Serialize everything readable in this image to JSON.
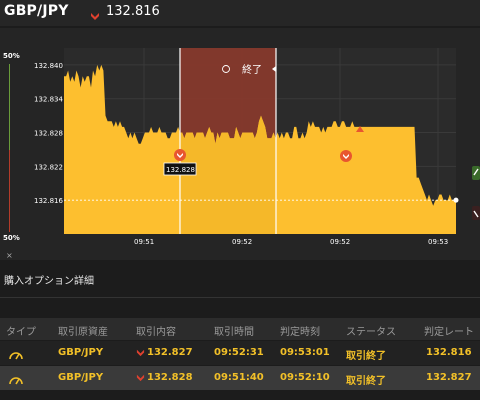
{
  "header": {
    "pair": "GBP/JPY",
    "rate": "132.816",
    "direction_icon": "down-arrow-icon",
    "colors": {
      "down": "#e0412f"
    }
  },
  "chart": {
    "gauge_top": "50%",
    "gauge_bottom": "50%",
    "close_symbol": "×",
    "end_label": "終了",
    "price_tag": "132.828"
  },
  "chart_data": {
    "type": "area",
    "x_tick_labels": [
      "09:51",
      "09:52",
      "09:52",
      "09:53"
    ],
    "y_tick_labels": [
      "132.840",
      "132.834",
      "132.828",
      "132.822",
      "132.816"
    ],
    "ylim": [
      132.81,
      132.843
    ],
    "y": [
      132.838,
      132.838,
      132.839,
      132.837,
      132.838,
      132.837,
      132.839,
      132.838,
      132.836,
      132.838,
      132.837,
      132.838,
      132.838,
      132.836,
      132.839,
      132.838,
      132.84,
      132.839,
      132.84,
      132.839,
      132.831,
      132.83,
      132.83,
      132.83,
      132.829,
      132.83,
      132.829,
      132.83,
      132.829,
      132.829,
      132.828,
      132.827,
      132.828,
      132.827,
      132.828,
      132.827,
      132.826,
      132.826,
      132.827,
      132.828,
      132.828,
      132.828,
      132.829,
      132.828,
      132.828,
      132.828,
      132.829,
      132.828,
      132.828,
      132.828,
      132.827,
      132.827,
      132.828,
      132.828,
      132.828,
      132.829,
      132.828,
      132.828,
      132.827,
      132.828,
      132.828,
      132.828,
      132.828,
      132.827,
      132.828,
      132.828,
      132.828,
      132.828,
      132.827,
      132.828,
      132.829,
      132.828,
      132.828,
      132.826,
      132.828,
      132.827,
      132.828,
      132.828,
      132.828,
      132.828,
      132.827,
      132.827,
      132.827,
      132.829,
      132.828,
      132.827,
      132.828,
      132.828,
      132.828,
      132.828,
      132.828,
      132.828,
      132.827,
      132.828,
      132.83,
      132.831,
      132.83,
      132.829,
      132.827,
      132.827,
      132.827,
      132.828,
      132.827,
      132.828,
      132.827,
      132.828,
      132.827,
      132.828,
      132.828,
      132.827,
      132.827,
      132.829,
      132.829,
      132.827,
      132.827,
      132.828,
      132.827,
      132.828,
      132.83,
      132.829,
      132.83,
      132.829,
      132.829,
      132.829,
      132.828,
      132.829,
      132.828,
      132.829,
      132.829,
      132.829,
      132.83,
      132.83,
      132.829,
      132.829,
      132.83,
      132.83,
      132.829,
      132.829,
      132.829,
      132.83,
      132.829,
      132.829,
      132.829,
      132.829,
      132.829,
      132.829,
      132.829,
      132.829,
      132.829,
      132.829,
      132.829,
      132.829,
      132.829,
      132.829,
      132.829,
      132.829,
      132.829,
      132.829,
      132.829,
      132.829,
      132.829,
      132.829,
      132.829,
      132.829,
      132.829,
      132.829,
      132.829,
      132.829,
      132.829,
      132.829,
      132.82,
      132.82,
      132.819,
      132.818,
      132.817,
      132.816,
      132.817,
      132.816,
      132.815,
      132.816,
      132.816,
      132.817,
      132.817,
      132.816,
      132.816,
      132.816,
      132.817,
      132.816,
      132.816,
      132.816
    ],
    "current_value": 132.816,
    "colors": {
      "area": "#fdbf2f",
      "highlight": "#8b3a2c"
    },
    "grid": true
  },
  "details": {
    "title": "購入オプション詳細"
  },
  "table": {
    "headers": [
      "タイプ",
      "取引原資産",
      "取引内容",
      "取引時間",
      "判定時刻",
      "ステータス",
      "判定レート"
    ],
    "rows": [
      {
        "type_icon": "gauge-icon",
        "asset": "GBP/JPY",
        "direction_icon": "down-arrow-icon",
        "price": "132.827",
        "time": "09:52:31",
        "judge": "09:53:01",
        "status": "取引終了",
        "rate": "132.816"
      },
      {
        "type_icon": "gauge-icon",
        "asset": "GBP/JPY",
        "direction_icon": "down-arrow-icon",
        "price": "132.828",
        "time": "09:51:40",
        "judge": "09:52:10",
        "status": "取引終了",
        "rate": "132.827"
      }
    ]
  }
}
